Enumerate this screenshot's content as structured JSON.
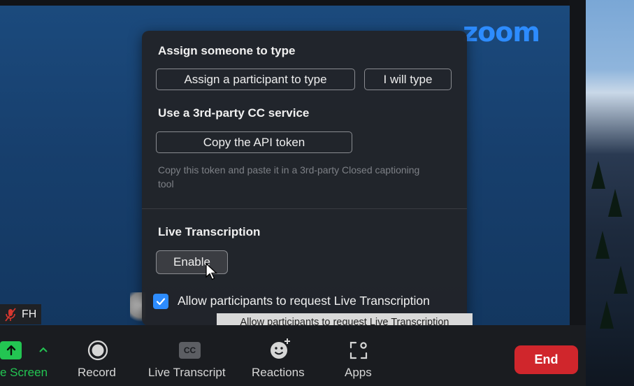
{
  "brand": {
    "logo_text": "zoom",
    "accent_color": "#2d8cff"
  },
  "cc_panel": {
    "assign": {
      "title": "Assign someone to type",
      "assign_participant_label": "Assign a participant to type",
      "i_will_type_label": "I will type"
    },
    "third_party": {
      "title": "Use a 3rd-party CC service",
      "copy_token_label": "Copy the API token",
      "hint": "Copy this token and paste it in a 3rd-party Closed captioning tool"
    },
    "live_transcription": {
      "title": "Live Transcription",
      "enable_label": "Enable",
      "allow_request_label": "Allow participants to request Live Transcription",
      "allow_request_checked": true
    }
  },
  "tooltip": {
    "text": "Allow participants to request Live Transcription"
  },
  "self_view": {
    "initials": "FH",
    "muted": true
  },
  "toolbar": {
    "share_label": "e Screen",
    "record_label": "Record",
    "live_transcript_label": "Live Transcript",
    "cc_badge": "CC",
    "reactions_label": "Reactions",
    "apps_label": "Apps",
    "end_label": "End",
    "end_color": "#d0262c",
    "share_color": "#23c552"
  }
}
